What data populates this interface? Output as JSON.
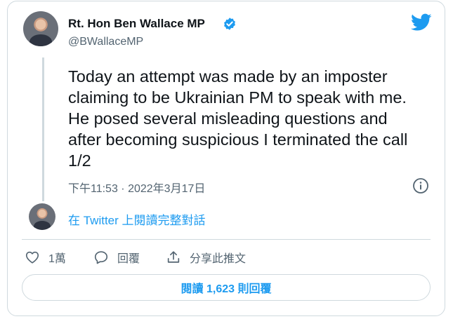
{
  "tweet": {
    "author_name": "Rt. Hon Ben Wallace MP",
    "handle": "@BWallaceMP",
    "text": "Today an attempt was made by an imposter\nclaiming to be Ukrainian PM to speak with me.\nHe posed several misleading questions and\nafter becoming suspicious I terminated the call\n1/2",
    "timestamp": "下午11:53 · 2022年3月17日",
    "thread_link": "在 Twitter 上閱讀完整對話"
  },
  "actions": {
    "like_count": "1萬",
    "reply_label": "回覆",
    "share_label": "分享此推文"
  },
  "read_replies_label": "閱讀 1,623 則回覆",
  "icons": {
    "verified": "verified-badge-icon",
    "brand": "twitter-bird-icon",
    "info": "info-icon",
    "like": "heart-icon",
    "reply": "speech-bubble-icon",
    "share": "share-upload-icon"
  },
  "colors": {
    "accent": "#1d9bf0",
    "text": "#0f1419",
    "muted": "#536471",
    "border": "#cfd9de"
  }
}
